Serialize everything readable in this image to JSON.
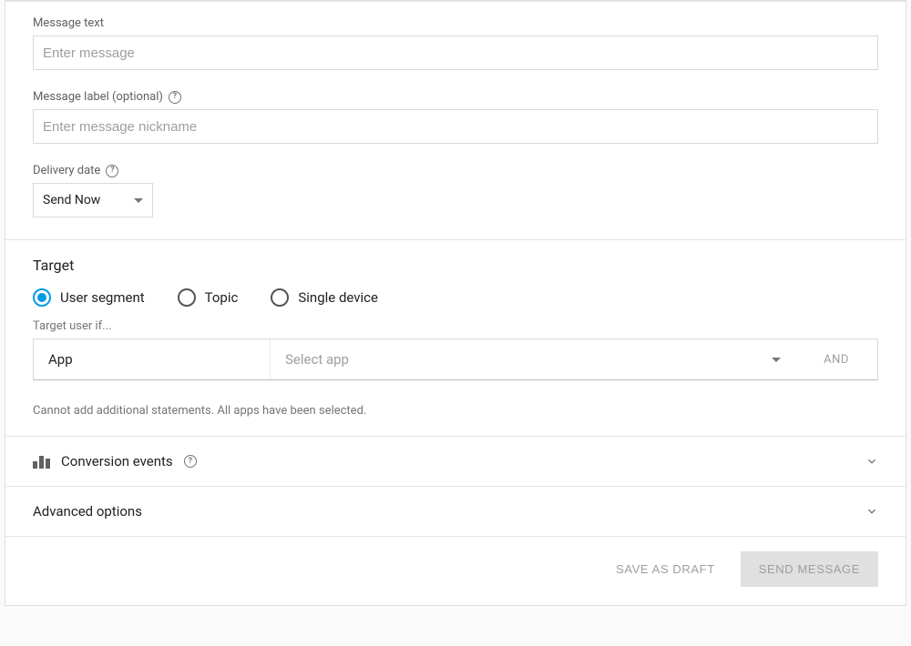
{
  "message": {
    "text_label": "Message text",
    "text_placeholder": "Enter message",
    "label_label": "Message label (optional)",
    "label_placeholder": "Enter message nickname",
    "delivery_label": "Delivery date",
    "delivery_value": "Send Now"
  },
  "target": {
    "title": "Target",
    "options": {
      "user_segment": "User segment",
      "topic": "Topic",
      "single_device": "Single device"
    },
    "sub_label": "Target user if...",
    "row": {
      "app_label": "App",
      "select_placeholder": "Select app",
      "and_label": "AND"
    },
    "info": "Cannot add additional statements. All apps have been selected."
  },
  "collapse": {
    "conversion": "Conversion events",
    "advanced": "Advanced options"
  },
  "footer": {
    "save_draft": "SAVE AS DRAFT",
    "send": "SEND MESSAGE"
  }
}
